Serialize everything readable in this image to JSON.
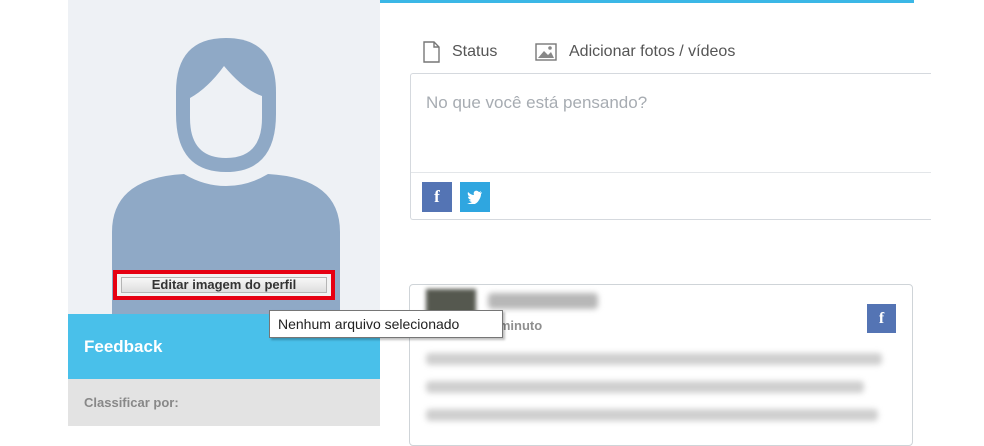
{
  "profile": {
    "edit_image_label": "Editar imagem do perfil"
  },
  "sidebar": {
    "feedback_title": "Feedback",
    "sort_label": "Classificar por:"
  },
  "composer": {
    "tabs": [
      {
        "label": "Status",
        "icon": "document-icon"
      },
      {
        "label": "Adicionar fotos / vídeos",
        "icon": "image-icon"
      }
    ],
    "placeholder": "No que você está pensando?",
    "share_buttons": [
      {
        "icon": "facebook-icon",
        "glyph": "f"
      },
      {
        "icon": "twitter-icon"
      }
    ]
  },
  "post": {
    "time": "1 minuto",
    "facebook_glyph": "f"
  },
  "tooltip": {
    "text": "Nenhum arquivo selecionado"
  },
  "colors": {
    "accent": "#3bb7e6",
    "feedback_bg": "#49c0ea",
    "avatar": "#8fa9c6",
    "highlight": "#e60012",
    "facebook": "#5474b4",
    "twitter": "#2fa6e0"
  }
}
